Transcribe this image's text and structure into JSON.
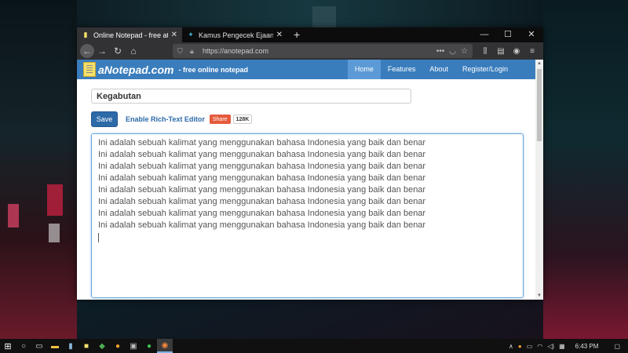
{
  "browser": {
    "tabs": [
      {
        "title": "Online Notepad - free at Anotepa",
        "active": true
      },
      {
        "title": "Kamus Pengecek Ejaan Bahasa In",
        "active": false
      }
    ],
    "url": "https://anotepad.com"
  },
  "site": {
    "logo_name": "aNotepad.com",
    "tagline": "- free online notepad",
    "nav": [
      "Home",
      "Features",
      "About",
      "Register/Login"
    ]
  },
  "note": {
    "title": "Kegabutan",
    "save_label": "Save",
    "rte_label": "Enable Rich-Text Editor",
    "share_label": "Share",
    "share_count": "128K",
    "lines": [
      "Ini adalah sebuah kalimat yang menggunakan bahasa Indonesia yang baik dan benar",
      "Ini adalah sebuah kalimat yang menggunakan bahasa Indonesia yang baik dan benar",
      "Ini adalah sebuah kalimat yang menggunakan bahasa Indonesia yang baik dan benar",
      "Ini adalah sebuah kalimat yang menggunakan bahasa Indonesia yang baik dan benar",
      "Ini adalah sebuah kalimat yang menggunakan bahasa Indonesia yang baik dan benar",
      "Ini adalah sebuah kalimat yang menggunakan bahasa Indonesia yang baik dan benar",
      "Ini adalah sebuah kalimat yang menggunakan bahasa Indonesia yang baik dan benar",
      "Ini adalah sebuah kalimat yang menggunakan bahasa Indonesia yang baik dan benar"
    ]
  },
  "taskbar": {
    "clock": "6:43 PM"
  },
  "colors": {
    "site_header": "#3a7dbd",
    "nav_active": "#5b9ad6",
    "save_button": "#2c6aa8",
    "share_button": "#e55a3c"
  }
}
